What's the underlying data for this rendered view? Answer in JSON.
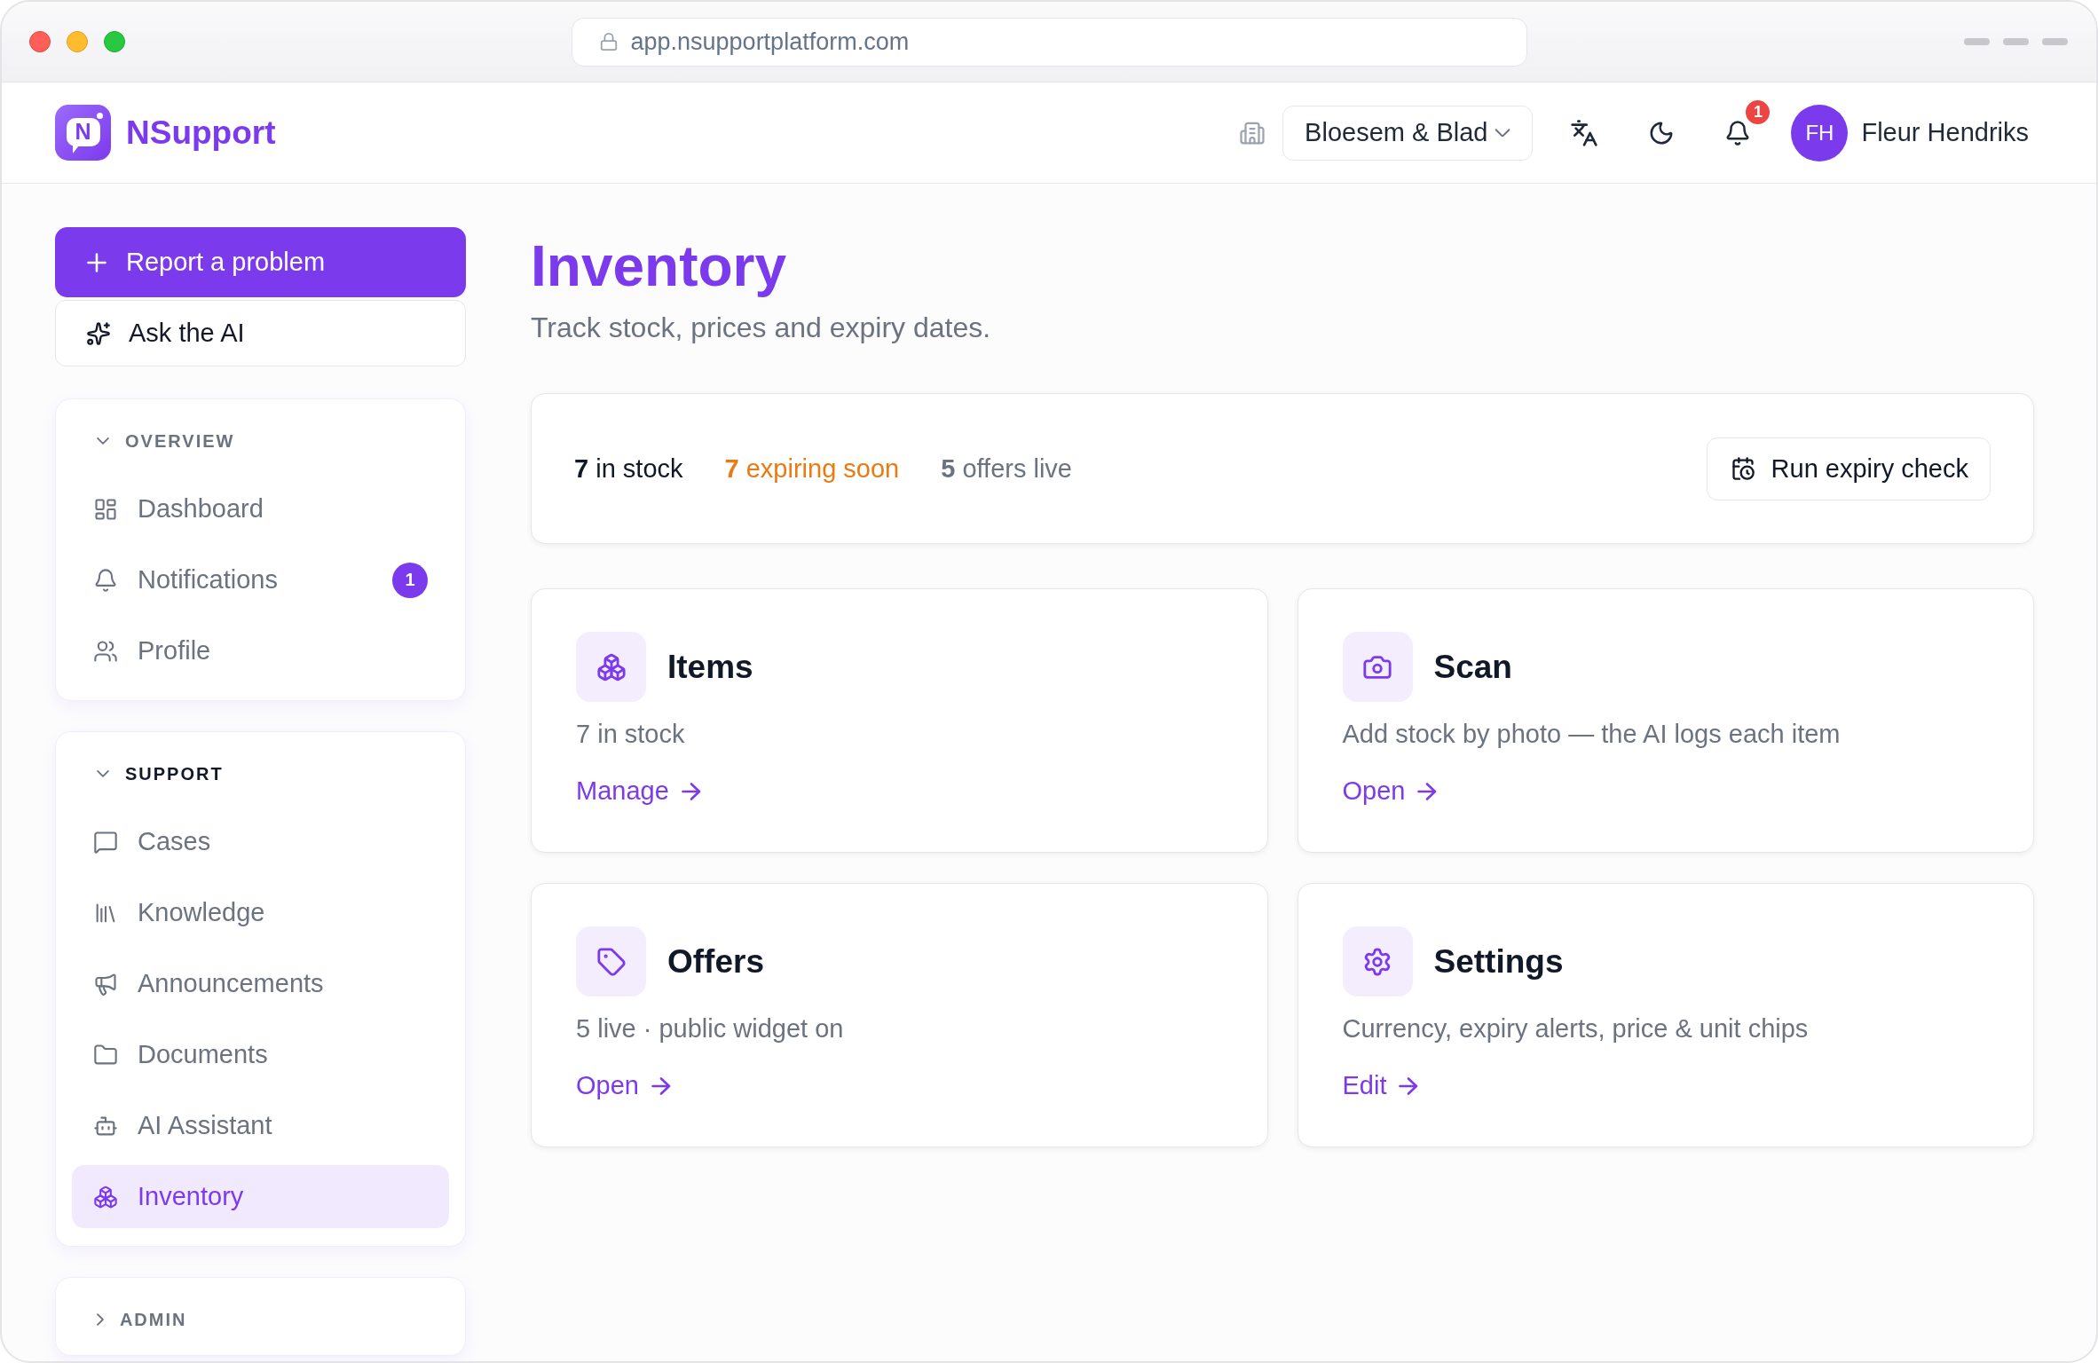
{
  "browser": {
    "url": "app.nsupportplatform.com"
  },
  "header": {
    "brand": {
      "logo_letter": "N",
      "name": "NSupport"
    },
    "workspace": {
      "value": "Bloesem & Blad"
    },
    "notifications": {
      "count": "1"
    },
    "user": {
      "initials": "FH",
      "name": "Fleur Hendriks"
    }
  },
  "sidebar": {
    "actions": [
      {
        "label": "Report a problem",
        "kind": "primary"
      },
      {
        "label": "Ask the AI",
        "kind": "secondary"
      }
    ],
    "sections": [
      {
        "title": "OVERVIEW",
        "expanded": true,
        "active": false,
        "items": [
          {
            "label": "Dashboard",
            "selected": false
          },
          {
            "label": "Notifications",
            "selected": false,
            "badge": "1"
          },
          {
            "label": "Profile",
            "selected": false
          }
        ]
      },
      {
        "title": "SUPPORT",
        "expanded": true,
        "active": true,
        "items": [
          {
            "label": "Cases",
            "selected": false
          },
          {
            "label": "Knowledge",
            "selected": false
          },
          {
            "label": "Announcements",
            "selected": false
          },
          {
            "label": "Documents",
            "selected": false
          },
          {
            "label": "AI Assistant",
            "selected": false
          },
          {
            "label": "Inventory",
            "selected": true
          }
        ]
      },
      {
        "title": "ADMIN",
        "expanded": false,
        "active": false
      }
    ]
  },
  "page": {
    "title": "Inventory",
    "subtitle": "Track stock, prices and expiry dates."
  },
  "summary": {
    "stats": [
      {
        "text": "**7** in stock",
        "color": "#111827"
      },
      {
        "text": "**7** expiring soon",
        "color": "#ea7a12"
      },
      {
        "text": "**5** offers live",
        "color": "#6b7280"
      }
    ],
    "action": "Run expiry check"
  },
  "cards": [
    {
      "title": "Items",
      "description": "7 in stock",
      "link": "Manage"
    },
    {
      "title": "Scan",
      "description": "Add stock by photo — the AI logs each item",
      "link": "Open"
    },
    {
      "title": "Offers",
      "description": "5 live · public widget on",
      "link": "Open"
    },
    {
      "title": "Settings",
      "description": "Currency, expiry alerts, price & unit chips",
      "link": "Edit"
    }
  ]
}
